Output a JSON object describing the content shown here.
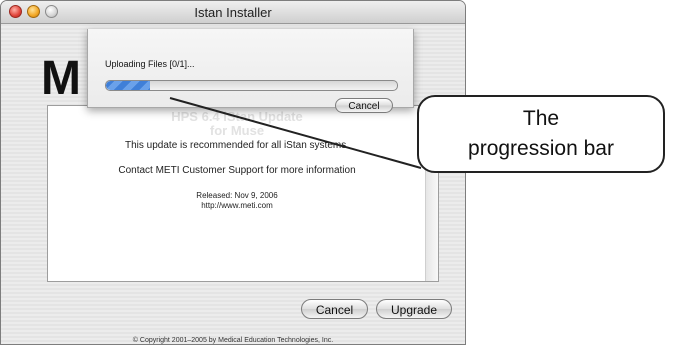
{
  "window": {
    "title": "Istan Installer"
  },
  "logo": {
    "text": "M"
  },
  "content": {
    "title_line1": "HPS 6.4 iStan Update",
    "title_line2": "for Muse",
    "line1": "This update is recommended for all iStan systems.",
    "line2": "Contact METI Customer Support for more information",
    "released": "Released: Nov 9, 2006",
    "url": "http://www.meti.com"
  },
  "buttons": {
    "cancel": "Cancel",
    "upgrade": "Upgrade"
  },
  "copyright": "© Copyright 2001–2005 by Medical Education Technologies, Inc.",
  "sheet": {
    "status": "Uploading Files [0/1]...",
    "cancel": "Cancel",
    "progress": 0.15
  },
  "callout": {
    "line1": "The",
    "line2": "progression bar"
  },
  "colors": {
    "progress": "#3f7fd8",
    "callout_border": "#222222"
  }
}
